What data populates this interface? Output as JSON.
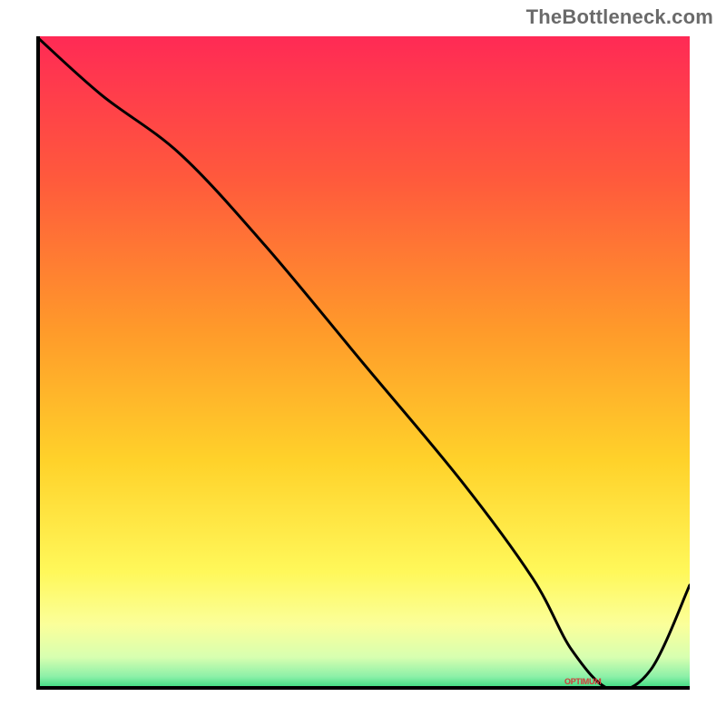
{
  "watermark": "TheBottleneck.com",
  "chart_data": {
    "type": "line",
    "title": "",
    "xlabel": "",
    "ylabel": "",
    "xlim": [
      0,
      100
    ],
    "ylim": [
      0,
      100
    ],
    "x": [
      0,
      10,
      22,
      35,
      50,
      65,
      76,
      82,
      88,
      94,
      100
    ],
    "values": [
      100,
      91,
      82,
      68,
      50,
      32,
      17,
      6,
      0,
      3,
      16
    ],
    "marker_x": 85,
    "marker_label": "OPTIMUM",
    "gradient_stops": [
      {
        "offset": 0,
        "color": "#ff2a55"
      },
      {
        "offset": 22,
        "color": "#ff5a3c"
      },
      {
        "offset": 45,
        "color": "#ff9a2a"
      },
      {
        "offset": 65,
        "color": "#ffd22a"
      },
      {
        "offset": 82,
        "color": "#fff85a"
      },
      {
        "offset": 90,
        "color": "#fbff9a"
      },
      {
        "offset": 95,
        "color": "#d8ffb0"
      },
      {
        "offset": 98,
        "color": "#8cf0a8"
      },
      {
        "offset": 100,
        "color": "#2ed87a"
      }
    ]
  }
}
